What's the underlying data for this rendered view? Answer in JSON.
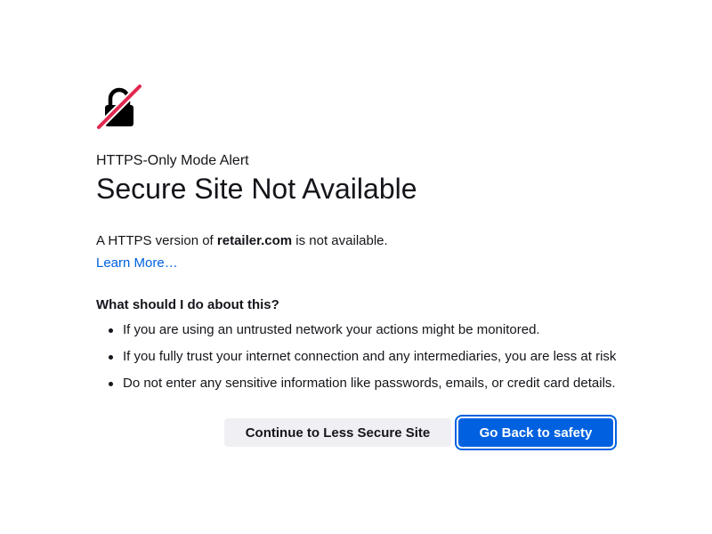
{
  "page": {
    "alert_label": "HTTPS-Only Mode Alert",
    "title": "Secure Site Not Available",
    "description_prefix": "A HTTPS version of ",
    "site_domain": "retailer.com",
    "description_suffix": " is not available.",
    "learn_more_label": "Learn More…"
  },
  "advice": {
    "heading": "What should I do about this?",
    "items": [
      "If you are using an untrusted network your actions might be monitored.",
      "If you fully trust your internet connection and any intermediaries, you are less at risk",
      "Do not enter any sensitive information like passwords, emails, or credit card details."
    ]
  },
  "buttons": {
    "continue_label": "Continue to Less Secure Site",
    "go_back_label": "Go Back to safety"
  },
  "icons": {
    "main_icon": "lock-slash-icon"
  },
  "colors": {
    "accent": "#0061e0",
    "danger_slash": "#e22850",
    "secondary_button_bg": "#f0f0f4",
    "text": "#15141a"
  }
}
